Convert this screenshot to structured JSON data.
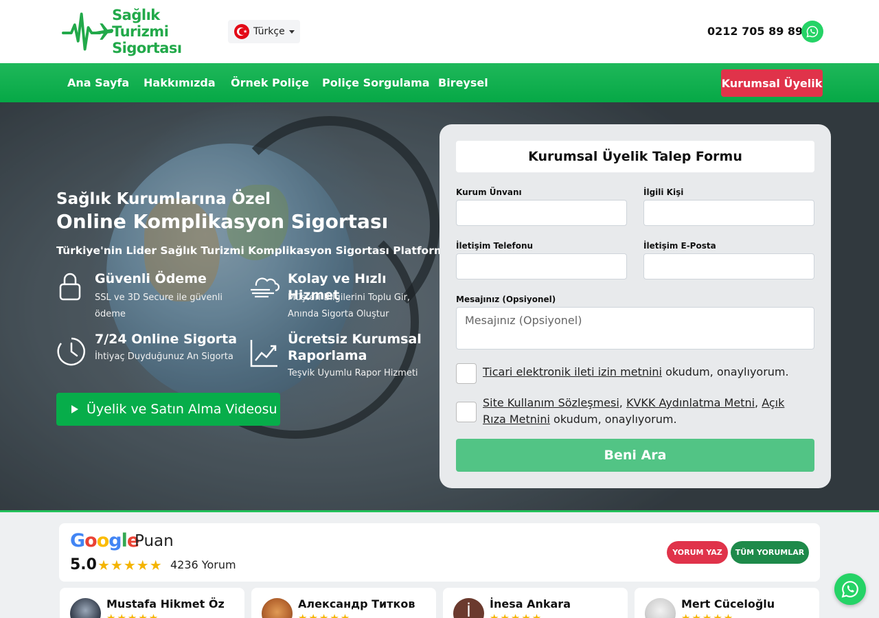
{
  "header": {
    "logo_line1": "Sağlık Turizmi",
    "logo_line2": "Sigortası",
    "language": "Türkçe",
    "phone": "0212 705 89 89"
  },
  "nav": {
    "items": [
      "Ana Sayfa",
      "Hakkımızda",
      "Örnek Poliçe",
      "Poliçe Sorgulama",
      "Bireysel"
    ],
    "cta": "Kurumsal Üyelik"
  },
  "hero": {
    "subtitle": "Sağlık Kurumlarına Özel",
    "title": "Online Komplikasyon Sigortası",
    "tagline": "Türkiye'nin Lider Sağlık Turizmi Komplikasyon Sigortası Platformu",
    "features": [
      {
        "icon": "lock-icon",
        "title": "Güvenli Ödeme",
        "desc": "SSL ve 3D Secure ile güvenli ödeme"
      },
      {
        "icon": "wind-icon",
        "title": "Kolay ve Hızlı Hizmet",
        "desc": "Müşteri Bilgilerini Toplu Gir, Anında Sigorta Oluştur"
      },
      {
        "icon": "clock-icon",
        "title": "7/24 Online Sigorta",
        "desc": "İhtiyaç Duyduğunuz An Sigorta"
      },
      {
        "icon": "chart-icon",
        "title": "Ücretsiz Kurumsal Raporlama",
        "desc": "Teşvik Uyumlu Rapor Hizmeti"
      }
    ],
    "video_button": "Üyelik ve Satın Alma Videosu"
  },
  "form": {
    "title": "Kurumsal Üyelik Talep Formu",
    "fields": {
      "kurum": {
        "label": "Kurum Ünvanı",
        "value": ""
      },
      "kisi": {
        "label": "İlgili Kişi",
        "value": ""
      },
      "telefon": {
        "label": "İletişim Telefonu",
        "value": ""
      },
      "eposta": {
        "label": "İletişim E-Posta",
        "value": ""
      },
      "mesaj": {
        "label": "Mesajınız (Opsiyonel)",
        "placeholder": "Mesajınız (Opsiyonel)",
        "value": ""
      }
    },
    "consent1": {
      "link": "Ticari elektronik ileti izin metnini",
      "text": " okudum, onaylıyorum."
    },
    "consent2": {
      "link1": "Site Kullanım Sözleşmesi",
      "sep1": ", ",
      "link2": "KVKK Aydınlatma Metni",
      "sep2": ", ",
      "link3": "Açık Rıza Metnini",
      "text": " okudum, onaylıyorum."
    },
    "submit": "Beni Ara"
  },
  "rating": {
    "google": "Google",
    "puan": "Puan",
    "score": "5.0",
    "stars": "★★★★★",
    "count": "4236 Yorum",
    "write_button": "YORUM YAZ",
    "all_button": "TÜM YORUMLAR"
  },
  "reviews": [
    {
      "name": "Mustafa Hikmet Öz",
      "stars": "★★★★★"
    },
    {
      "name": "Александр Титков",
      "stars": "★★★★★"
    },
    {
      "name": "İnesa Ankara",
      "stars": "★★★★★",
      "initial": "İ"
    },
    {
      "name": "Mert Cüceloğlu",
      "stars": "★★★★★"
    }
  ],
  "colors": {
    "brand_green": "#06a846",
    "cta_red": "#e0334a",
    "submit_green": "#52c485",
    "whatsapp": "#25d366"
  }
}
